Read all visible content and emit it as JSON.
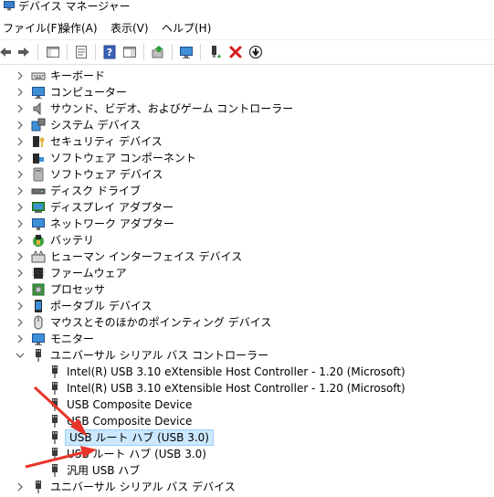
{
  "window": {
    "title": "デバイス マネージャー"
  },
  "menu": {
    "file": "ファイル(F)",
    "action": "操作(A)",
    "view": "表示(V)",
    "help": "ヘルプ(H)"
  },
  "tree": {
    "categories": [
      {
        "label": "キーボード",
        "icon": "keyboard-icon"
      },
      {
        "label": "コンピューター",
        "icon": "computer-icon"
      },
      {
        "label": "サウンド、ビデオ、およびゲーム コントローラー",
        "icon": "speaker-icon"
      },
      {
        "label": "システム デバイス",
        "icon": "system-device-icon"
      },
      {
        "label": "セキュリティ デバイス",
        "icon": "security-key-icon"
      },
      {
        "label": "ソフトウェア コンポーネント",
        "icon": "software-component-icon"
      },
      {
        "label": "ソフトウェア デバイス",
        "icon": "software-device-icon"
      },
      {
        "label": "ディスク ドライブ",
        "icon": "disk-drive-icon"
      },
      {
        "label": "ディスプレイ アダプター",
        "icon": "display-adapter-icon"
      },
      {
        "label": "ネットワーク アダプター",
        "icon": "network-adapter-icon"
      },
      {
        "label": "バッテリ",
        "icon": "battery-icon"
      },
      {
        "label": "ヒューマン インターフェイス デバイス",
        "icon": "hid-icon"
      },
      {
        "label": "ファームウェア",
        "icon": "firmware-icon"
      },
      {
        "label": "プロセッサ",
        "icon": "processor-icon"
      },
      {
        "label": "ポータブル デバイス",
        "icon": "portable-device-icon"
      },
      {
        "label": "マウスとそのほかのポインティング デバイス",
        "icon": "mouse-icon"
      },
      {
        "label": "モニター",
        "icon": "monitor-icon"
      }
    ],
    "usb_category": {
      "label": "ユニバーサル シリアル バス コントローラー",
      "icon": "usb-icon"
    },
    "usb_children": [
      {
        "label": "Intel(R) USB 3.10 eXtensible Host Controller - 1.20 (Microsoft)"
      },
      {
        "label": "Intel(R) USB 3.10 eXtensible Host Controller - 1.20 (Microsoft)"
      },
      {
        "label": "USB Composite Device"
      },
      {
        "label": "USB Composite Device"
      },
      {
        "label": "USB ルート ハブ (USB 3.0)",
        "selected": true
      },
      {
        "label": "USB ルート ハブ (USB 3.0)"
      },
      {
        "label": "汎用 USB ハブ"
      }
    ],
    "last_category": {
      "label": "ユニバーサル シリアル バス デバイス",
      "icon": "usb-icon"
    }
  },
  "colors": {
    "selection_bg": "#cce8ff",
    "selection_border": "#99d1ff",
    "annotation_arrow": "#e8352c",
    "delete_x": "#d21f1f"
  }
}
